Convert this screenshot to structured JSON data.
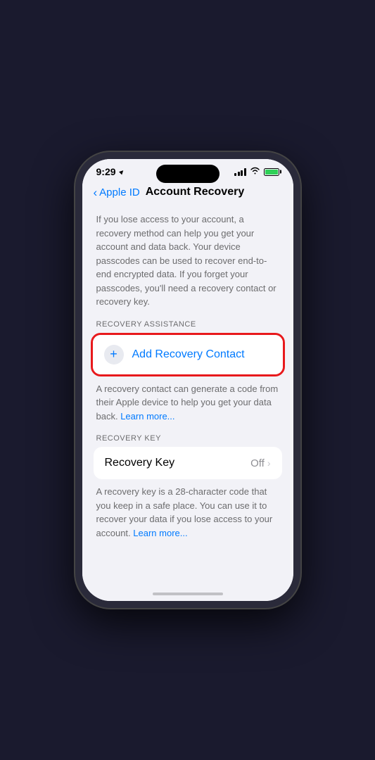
{
  "status_bar": {
    "time": "9:29",
    "location_arrow": "▲",
    "battery_level": 100
  },
  "nav": {
    "back_label": "Apple ID",
    "page_title": "Account Recovery"
  },
  "main": {
    "description": "If you lose access to your account, a recovery method can help you get your account and data back. Your device passcodes can be used to recover end-to-end encrypted data. If you forget your passcodes, you'll need a recovery contact or recovery key.",
    "section1": {
      "label": "RECOVERY ASSISTANCE",
      "add_button": "Add Recovery Contact",
      "sub_text": "A recovery contact can generate a code from their Apple device to help you get your data back.",
      "learn_more": "Learn more..."
    },
    "section2": {
      "label": "RECOVERY KEY",
      "key_label": "Recovery Key",
      "key_value": "Off",
      "sub_text": "A recovery key is a 28-character code that you keep in a safe place. You can use it to recover your data if you lose access to your account.",
      "learn_more": "Learn more..."
    }
  }
}
